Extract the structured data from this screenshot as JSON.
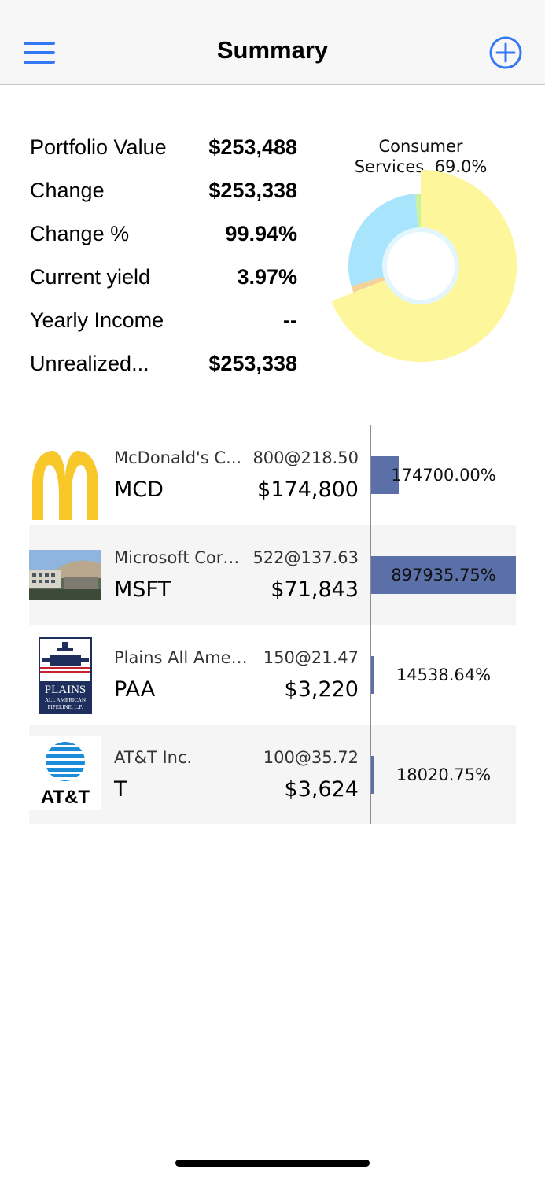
{
  "nav": {
    "title": "Summary",
    "menu_icon": "hamburger-menu-icon",
    "add_icon": "plus-circle-icon",
    "accent": "#3478f6"
  },
  "summary": {
    "rows": [
      {
        "label": "Portfolio Value",
        "value": "$253,488"
      },
      {
        "label": "Change",
        "value": "$253,338"
      },
      {
        "label": "Change %",
        "value": "99.94%"
      },
      {
        "label": "Current yield",
        "value": "3.97%"
      },
      {
        "label": "Yearly Income",
        "value": "--"
      },
      {
        "label": "Unrealized...",
        "value": "$253,338"
      }
    ]
  },
  "chart_data": {
    "type": "pie",
    "labels_shown": [
      "Consumer\nServices, 69.0%"
    ],
    "label_line1": "Consumer",
    "label_line2": "Services, 69.0%",
    "slices": [
      {
        "value": 69.0,
        "color": "#fdf69b",
        "highlighted": true
      },
      {
        "value": 1.5,
        "color": "#f2d29a"
      },
      {
        "value": 28.3,
        "color": "#a8e4fb"
      },
      {
        "value": 1.2,
        "color": "#c8f2a0"
      }
    ]
  },
  "holdings": [
    {
      "name": "McDonald's C...",
      "shares": "800@218.50",
      "ticker": "MCD",
      "value": "$174,800",
      "gain": "174700.00%",
      "gain_fraction": 0.19,
      "logo": "mcdonalds-logo"
    },
    {
      "name": "Microsoft Corp...",
      "shares": "522@137.63",
      "ticker": "MSFT",
      "value": "$71,843",
      "gain": "897935.75%",
      "gain_fraction": 1.0,
      "logo": "microsoft-campus-photo"
    },
    {
      "name": "Plains All Ameri...",
      "shares": "150@21.47",
      "ticker": "PAA",
      "value": "$3,220",
      "gain": "14538.64%",
      "gain_fraction": 0.016,
      "logo": "plains-all-american-logo"
    },
    {
      "name": "AT&T Inc.",
      "shares": "100@35.72",
      "ticker": "T",
      "value": "$3,624",
      "gain": "18020.75%",
      "gain_fraction": 0.02,
      "logo": "att-logo"
    }
  ],
  "logos": {
    "plains_line1": "PLAINS",
    "plains_line2": "ALL AMERICAN",
    "plains_line3": "PIPELINE, L.P.",
    "att_text": "AT&T"
  },
  "colors": {
    "bar": "#5b6fa8",
    "row_alt": "#f5f5f5"
  }
}
